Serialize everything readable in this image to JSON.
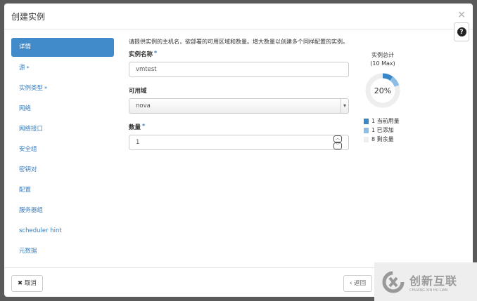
{
  "modal": {
    "title": "创建实例",
    "close": "×",
    "help": "?"
  },
  "nav": [
    {
      "label": "详情",
      "active": true
    },
    {
      "label": "源",
      "required": true
    },
    {
      "label": "实例类型",
      "required": true
    },
    {
      "label": "网络"
    },
    {
      "label": "网络接口"
    },
    {
      "label": "安全组"
    },
    {
      "label": "密钥对"
    },
    {
      "label": "配置"
    },
    {
      "label": "服务器组"
    },
    {
      "label": "scheduler hint"
    },
    {
      "label": "元数据"
    }
  ],
  "form": {
    "intro": "请提供实例的主机名，欲部署的可用区域和数量。增大数量以创建多个同样配置的实例。",
    "name_label": "实例名称",
    "name_value": "vmtest",
    "az_label": "可用域",
    "az_value": "nova",
    "count_label": "数量",
    "count_value": "1",
    "required_mark": "*"
  },
  "quota": {
    "title": "实例总计",
    "max": "(10 Max)",
    "percent_label": "20%",
    "percent": 20,
    "legend": [
      {
        "count": "1",
        "label": "当前用量",
        "color": "#3a87c8"
      },
      {
        "count": "1",
        "label": "已添加",
        "color": "#8cbde6"
      },
      {
        "count": "8",
        "label": "剩余量",
        "color": "#eeeeee"
      }
    ]
  },
  "footer": {
    "cancel": "取消",
    "back": "返回"
  },
  "watermark": {
    "text": "创新互联",
    "sub": "CHUANG XIN HU LIAN"
  }
}
